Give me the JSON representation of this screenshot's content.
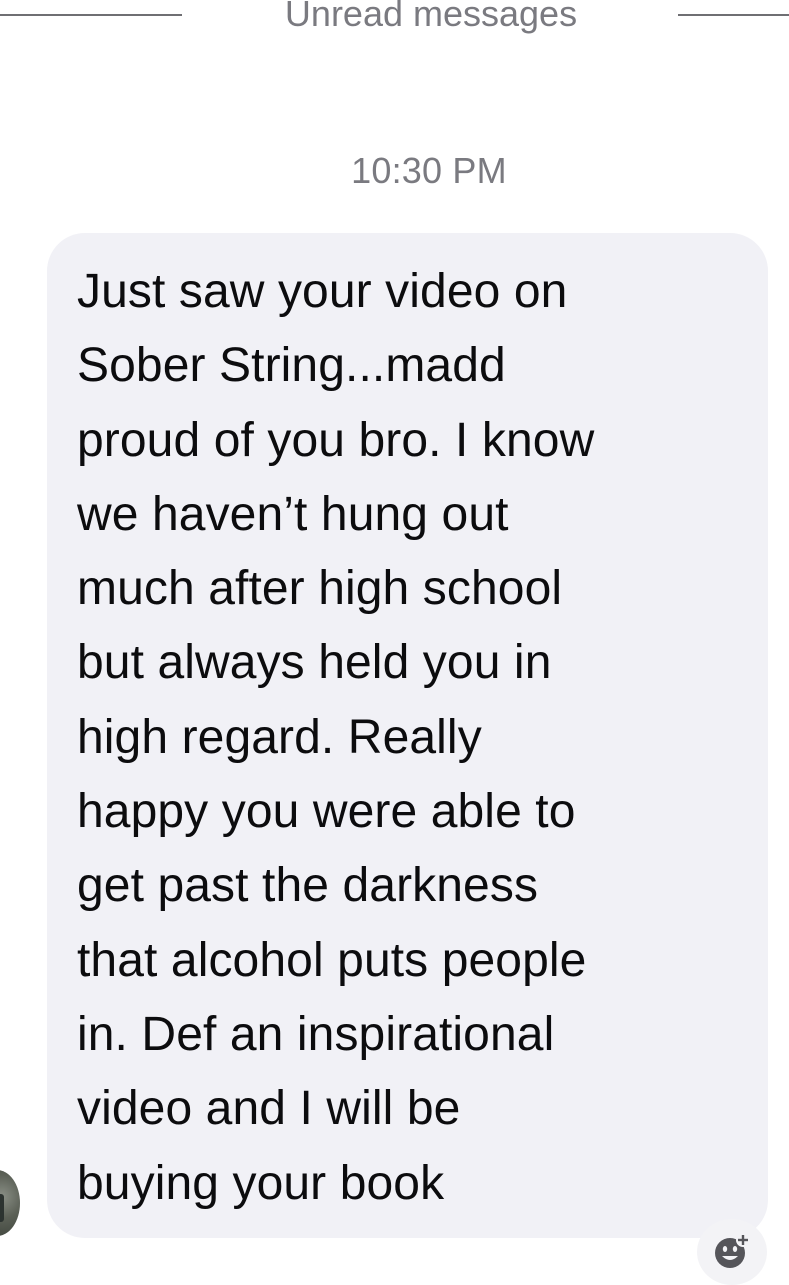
{
  "divider": {
    "label": "Unread messages"
  },
  "thread": {
    "timestamp": "10:30 PM"
  },
  "message": {
    "text": "Just saw your video on\nSober String...madd\nproud of you bro.  I know\nwe haven’t hung out\nmuch after high school\nbut always held you in\nhigh regard.  Really\nhappy you were able to\nget past the darkness\nthat alcohol puts people\nin.  Def an inspirational\nvideo and I will be\nbuying your book"
  },
  "icons": {
    "avatar": "sender-avatar",
    "reaction": "add-reaction-icon"
  },
  "colors": {
    "bubble": "#f1f1f6",
    "text": "#0c0c0e",
    "meta_text": "#7a7a80"
  }
}
